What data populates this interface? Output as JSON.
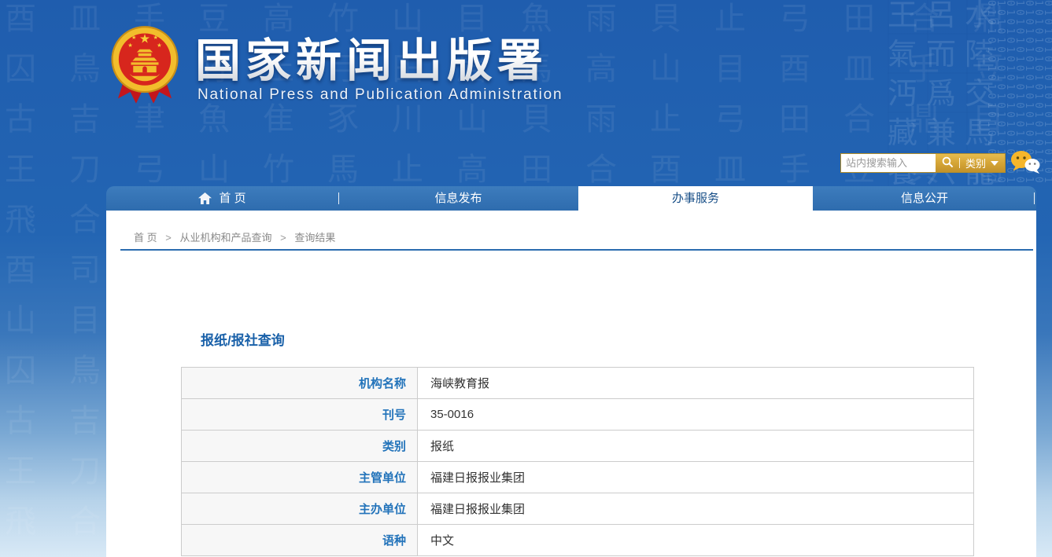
{
  "header": {
    "site_title": "国家新闻出版署",
    "site_subtitle": "National Press and Publication Administration",
    "logo_name": "china-national-emblem",
    "search": {
      "placeholder": "站内搜索输入",
      "category_label": "类别",
      "divider": "|"
    }
  },
  "nav": {
    "items": [
      {
        "label": "首 页",
        "icon": "home-icon",
        "active": false
      },
      {
        "label": "信息发布",
        "active": false
      },
      {
        "label": "办事服务",
        "active": true
      },
      {
        "label": "信息公开",
        "active": false
      }
    ]
  },
  "breadcrumb": {
    "separator": ">",
    "items": [
      "首 页",
      "从业机构和产品查询",
      "查询结果"
    ]
  },
  "main": {
    "title": "报纸/报社查询",
    "table": {
      "rows": [
        {
          "label": "机构名称",
          "value": "海峡教育报"
        },
        {
          "label": "刊号",
          "value": "35-0016"
        },
        {
          "label": "类别",
          "value": "报纸"
        },
        {
          "label": "主管单位",
          "value": "福建日报报业集团"
        },
        {
          "label": "主办单位",
          "value": "福建日报报业集团"
        },
        {
          "label": "语种",
          "value": "中文"
        }
      ]
    }
  },
  "colors": {
    "background_blue": "#2365b3",
    "nav_blue": "#2e6cae",
    "accent_gold": "#d3a335",
    "label_blue": "#2273ba",
    "title_blue": "#1a61a9",
    "active_tab_text": "#174e87",
    "breadcrumb_gray": "#888888",
    "table_border": "#cccccc"
  },
  "decor": {
    "oracle_glyphs": "酉皿手豆高竹山目魚雨貝止弓田合鼎\n囚鳥月竹止弓田眉馬高山目酉皿手豆\n古吉聿魚隹豕川山貝雨止弓田合鼎目\n王刀弓山竹馬止高田合酉皿手豆貝雨\n飛合帚止目山曰隹魚田古吉聿魚隹豕\n酉司甘鼎目貝山止高雨王刀弓山竹馬\n山目魚雨貝止弓田合鼎酉皿手豆高竹\n囚鳥月竹止弓田眉馬高飛合帚止目山\n古吉聿魚隹豕川山貝雨酉司甘鼎目貝\n王刀弓山竹馬止高田合山目魚雨貝止\n飛合帚止目山曰隹魚田囚鳥月竹止弓",
    "type_blocks": "王呂水\n氣而陸\n沔爲交\n藏兼馬\n養六龍\n王呂水",
    "binary_columns": "01010101010101010101\n10101010101010101010\n01010101010101010101\n10101010101010101010\n01010101010101010101\n10101010101010101010\n01010101010101010101"
  }
}
